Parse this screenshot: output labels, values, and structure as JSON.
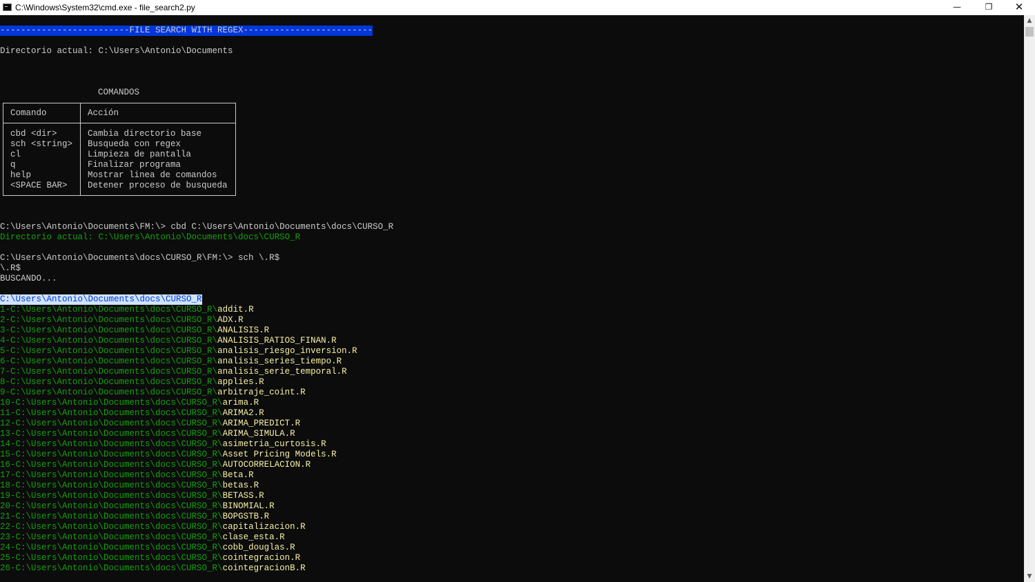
{
  "window": {
    "title": "C:\\Windows\\System32\\cmd.exe - file_search2.py",
    "minimize_glyph": "—",
    "restore_glyph": "❐",
    "close_glyph": "✕"
  },
  "console": {
    "banner": "-------------------------FILE SEARCH WITH REGEX-------------------------",
    "current_dir": "Directorio actual: C:\\Users\\Antonio\\Documents",
    "commands_title": "COMANDOS",
    "table": {
      "headers": [
        "Comando",
        "Acción"
      ],
      "rows": [
        {
          "cmd": "cbd <dir>",
          "action": "Cambia directorio base"
        },
        {
          "cmd": "sch <string>",
          "action": "Busqueda con regex"
        },
        {
          "cmd": "cl",
          "action": "Limpieza de pantalla"
        },
        {
          "cmd": "q",
          "action": "Finalizar programa"
        },
        {
          "cmd": "help",
          "action": "Mostrar linea de comandos"
        },
        {
          "cmd": "<SPACE BAR>",
          "action": "Detener proceso de busqueda"
        }
      ]
    },
    "prompt1": "C:\\Users\\Antonio\\Documents\\FM:\\> cbd C:\\Users\\Antonio\\Documents\\docs\\CURSO_R",
    "dir_changed": "Directorio actual: C:\\Users\\Antonio\\Documents\\docs\\CURSO_R",
    "prompt2": "C:\\Users\\Antonio\\Documents\\docs\\CURSO_R\\FM:\\> sch \\.R$",
    "echo": "\\.R$",
    "searching": "BUSCANDO...",
    "result_dir": "C:\\Users\\Antonio\\Documents\\docs\\CURSO_R",
    "results": [
      {
        "prefix": "1-C:\\Users\\Antonio\\Documents\\docs\\CURSO_R\\",
        "file": "addit.R"
      },
      {
        "prefix": "2-C:\\Users\\Antonio\\Documents\\docs\\CURSO_R\\",
        "file": "ADX.R"
      },
      {
        "prefix": "3-C:\\Users\\Antonio\\Documents\\docs\\CURSO_R\\",
        "file": "ANALISIS.R"
      },
      {
        "prefix": "4-C:\\Users\\Antonio\\Documents\\docs\\CURSO_R\\",
        "file": "ANALISIS_RATIOS_FINAN.R"
      },
      {
        "prefix": "5-C:\\Users\\Antonio\\Documents\\docs\\CURSO_R\\",
        "file": "analisis_riesgo_inversion.R"
      },
      {
        "prefix": "6-C:\\Users\\Antonio\\Documents\\docs\\CURSO_R\\",
        "file": "analisis_series_tiempo.R"
      },
      {
        "prefix": "7-C:\\Users\\Antonio\\Documents\\docs\\CURSO_R\\",
        "file": "analisis_serie_temporal.R"
      },
      {
        "prefix": "8-C:\\Users\\Antonio\\Documents\\docs\\CURSO_R\\",
        "file": "applies.R"
      },
      {
        "prefix": "9-C:\\Users\\Antonio\\Documents\\docs\\CURSO_R\\",
        "file": "arbitraje_coint.R"
      },
      {
        "prefix": "10-C:\\Users\\Antonio\\Documents\\docs\\CURSO_R\\",
        "file": "arima.R"
      },
      {
        "prefix": "11-C:\\Users\\Antonio\\Documents\\docs\\CURSO_R\\",
        "file": "ARIMA2.R"
      },
      {
        "prefix": "12-C:\\Users\\Antonio\\Documents\\docs\\CURSO_R\\",
        "file": "ARIMA_PREDICT.R"
      },
      {
        "prefix": "13-C:\\Users\\Antonio\\Documents\\docs\\CURSO_R\\",
        "file": "ARIMA_SIMULA.R"
      },
      {
        "prefix": "14-C:\\Users\\Antonio\\Documents\\docs\\CURSO_R\\",
        "file": "asimetria_curtosis.R"
      },
      {
        "prefix": "15-C:\\Users\\Antonio\\Documents\\docs\\CURSO_R\\",
        "file": "Asset Pricing Models.R"
      },
      {
        "prefix": "16-C:\\Users\\Antonio\\Documents\\docs\\CURSO_R\\",
        "file": "AUTOCORRELACION.R"
      },
      {
        "prefix": "17-C:\\Users\\Antonio\\Documents\\docs\\CURSO_R\\",
        "file": "Beta.R"
      },
      {
        "prefix": "18-C:\\Users\\Antonio\\Documents\\docs\\CURSO_R\\",
        "file": "betas.R"
      },
      {
        "prefix": "19-C:\\Users\\Antonio\\Documents\\docs\\CURSO_R\\",
        "file": "BETASS.R"
      },
      {
        "prefix": "20-C:\\Users\\Antonio\\Documents\\docs\\CURSO_R\\",
        "file": "BINOMIAL.R"
      },
      {
        "prefix": "21-C:\\Users\\Antonio\\Documents\\docs\\CURSO_R\\",
        "file": "BOPGSTB.R"
      },
      {
        "prefix": "22-C:\\Users\\Antonio\\Documents\\docs\\CURSO_R\\",
        "file": "capitalizacion.R"
      },
      {
        "prefix": "23-C:\\Users\\Antonio\\Documents\\docs\\CURSO_R\\",
        "file": "clase_esta.R"
      },
      {
        "prefix": "24-C:\\Users\\Antonio\\Documents\\docs\\CURSO_R\\",
        "file": "cobb_douglas.R"
      },
      {
        "prefix": "25-C:\\Users\\Antonio\\Documents\\docs\\CURSO_R\\",
        "file": "cointegracion.R"
      },
      {
        "prefix": "26-C:\\Users\\Antonio\\Documents\\docs\\CURSO_R\\",
        "file": "cointegracionB.R"
      }
    ]
  },
  "scrollbar": {
    "up_glyph": "▲",
    "down_glyph": "▼"
  },
  "colors": {
    "background": "#0c0c0c",
    "text": "#cccccc",
    "banner_bg": "#0037da",
    "green": "#13a10e",
    "yellow": "#f9f1a5"
  }
}
